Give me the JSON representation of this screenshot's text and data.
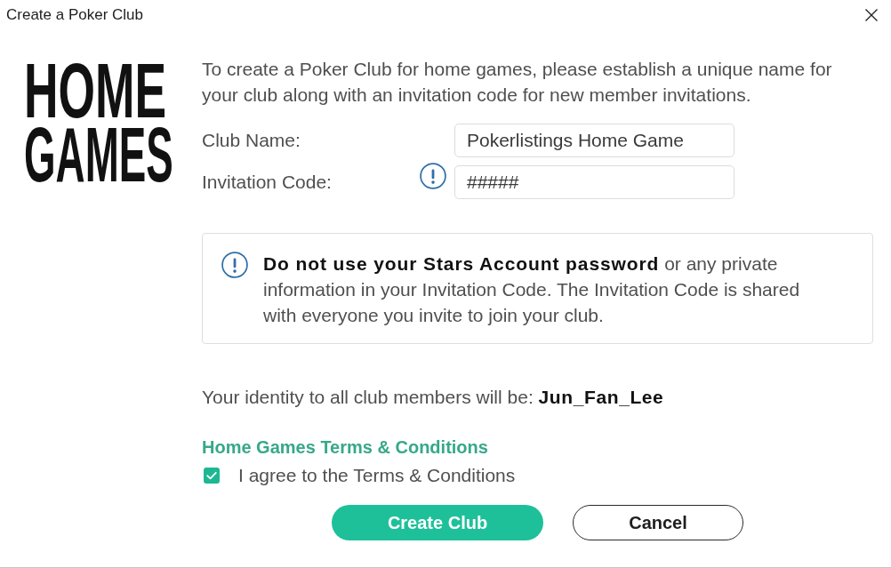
{
  "window": {
    "title": "Create a Poker Club"
  },
  "logo": {
    "lines": [
      "HOME",
      "GAMES"
    ]
  },
  "intro": "To create a Poker Club for home games, please establish a unique name for your club along with an invitation code for new member invitations.",
  "fields": [
    {
      "label": "Club Name:",
      "value": "Pokerlistings Home Game",
      "info": false
    },
    {
      "label": "Invitation Code:",
      "value": "#####",
      "info": true
    }
  ],
  "warning": {
    "text": "**Do not use your Stars Account password** or any private information in your Invitation Code. The Invitation Code is shared with everyone you invite to join your club."
  },
  "identity": "Your identity to all club members will be: **Jun_Fan_Lee**",
  "terms_link": "Home Games Terms & Conditions",
  "agree": {
    "label": "I agree to the Terms & Conditions",
    "checked": true
  },
  "buttons": [
    {
      "label": "Create Club",
      "kind": "primary"
    },
    {
      "label": "Cancel",
      "kind": "secondary"
    }
  ]
}
